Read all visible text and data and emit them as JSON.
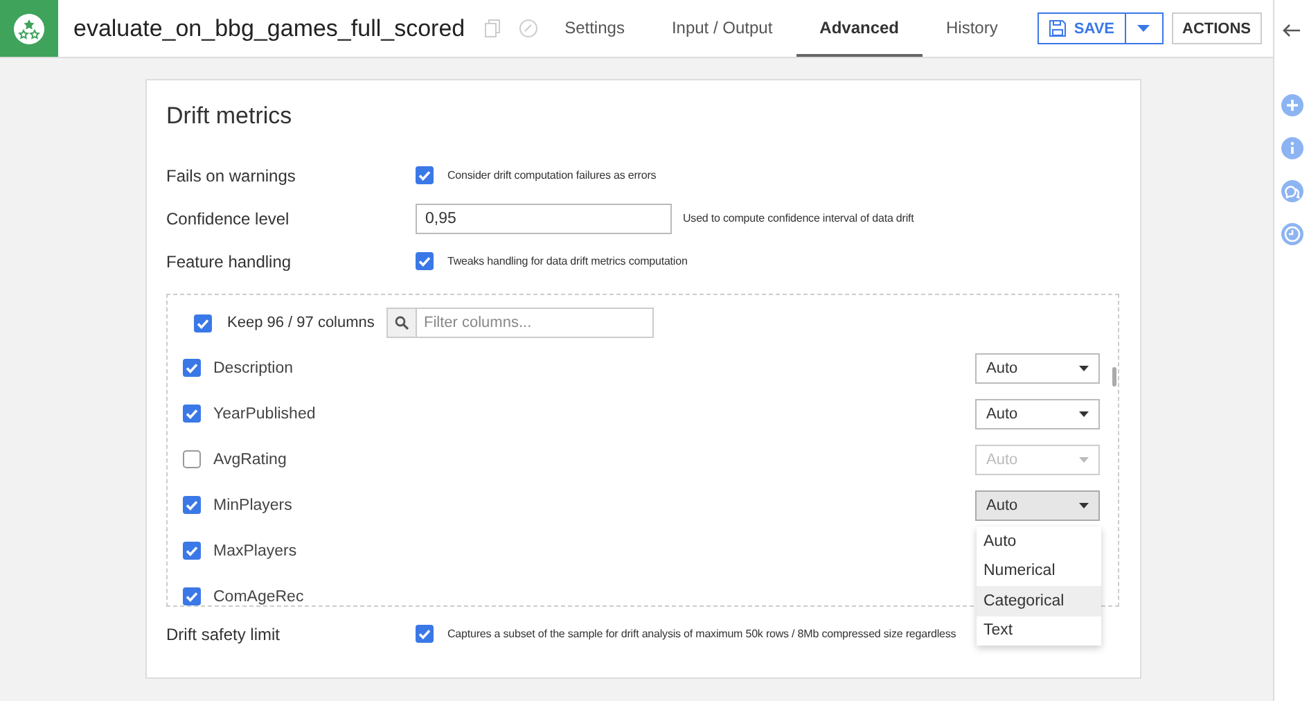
{
  "topbar": {
    "title": "evaluate_on_bbg_games_full_scored",
    "tabs": [
      {
        "label": "Settings",
        "selected": false
      },
      {
        "label": "Input / Output",
        "selected": false
      },
      {
        "label": "Advanced",
        "selected": true
      },
      {
        "label": "History",
        "selected": false
      }
    ],
    "save_button": "SAVE",
    "actions_button": "ACTIONS"
  },
  "card": {
    "title": "Drift metrics",
    "fails_on_warnings": {
      "label": "Fails on warnings",
      "checked": true,
      "hint": "Consider drift computation failures as errors"
    },
    "confidence_level": {
      "label": "Confidence level",
      "value": "0,95",
      "hint": "Used to compute confidence interval of data drift"
    },
    "feature_handling": {
      "label": "Feature handling",
      "checked": true,
      "hint": "Tweaks handling for data drift metrics computation"
    },
    "columns_panel": {
      "keep_all_checked": true,
      "keep_label": "Keep 96 / 97 columns",
      "filter": {
        "placeholder": "Filter columns..."
      },
      "columns": [
        {
          "name": "Description",
          "checked": true,
          "type": "Auto",
          "disabled": false,
          "open": false
        },
        {
          "name": "YearPublished",
          "checked": true,
          "type": "Auto",
          "disabled": false,
          "open": false
        },
        {
          "name": "AvgRating",
          "checked": false,
          "type": "Auto",
          "disabled": true,
          "open": false
        },
        {
          "name": "MinPlayers",
          "checked": true,
          "type": "Auto",
          "disabled": false,
          "open": true,
          "options": [
            {
              "label": "Auto",
              "hovered": false
            },
            {
              "label": "Numerical",
              "hovered": false
            },
            {
              "label": "Categorical",
              "hovered": true
            },
            {
              "label": "Text",
              "hovered": false
            }
          ]
        },
        {
          "name": "MaxPlayers",
          "checked": true
        },
        {
          "name": "ComAgeRec",
          "checked": true
        }
      ]
    },
    "drift_safety_limit": {
      "label": "Drift safety limit",
      "checked": true,
      "hint": "Captures a subset of the sample for drift analysis of maximum 50k rows / 8Mb compressed size regardless"
    }
  }
}
